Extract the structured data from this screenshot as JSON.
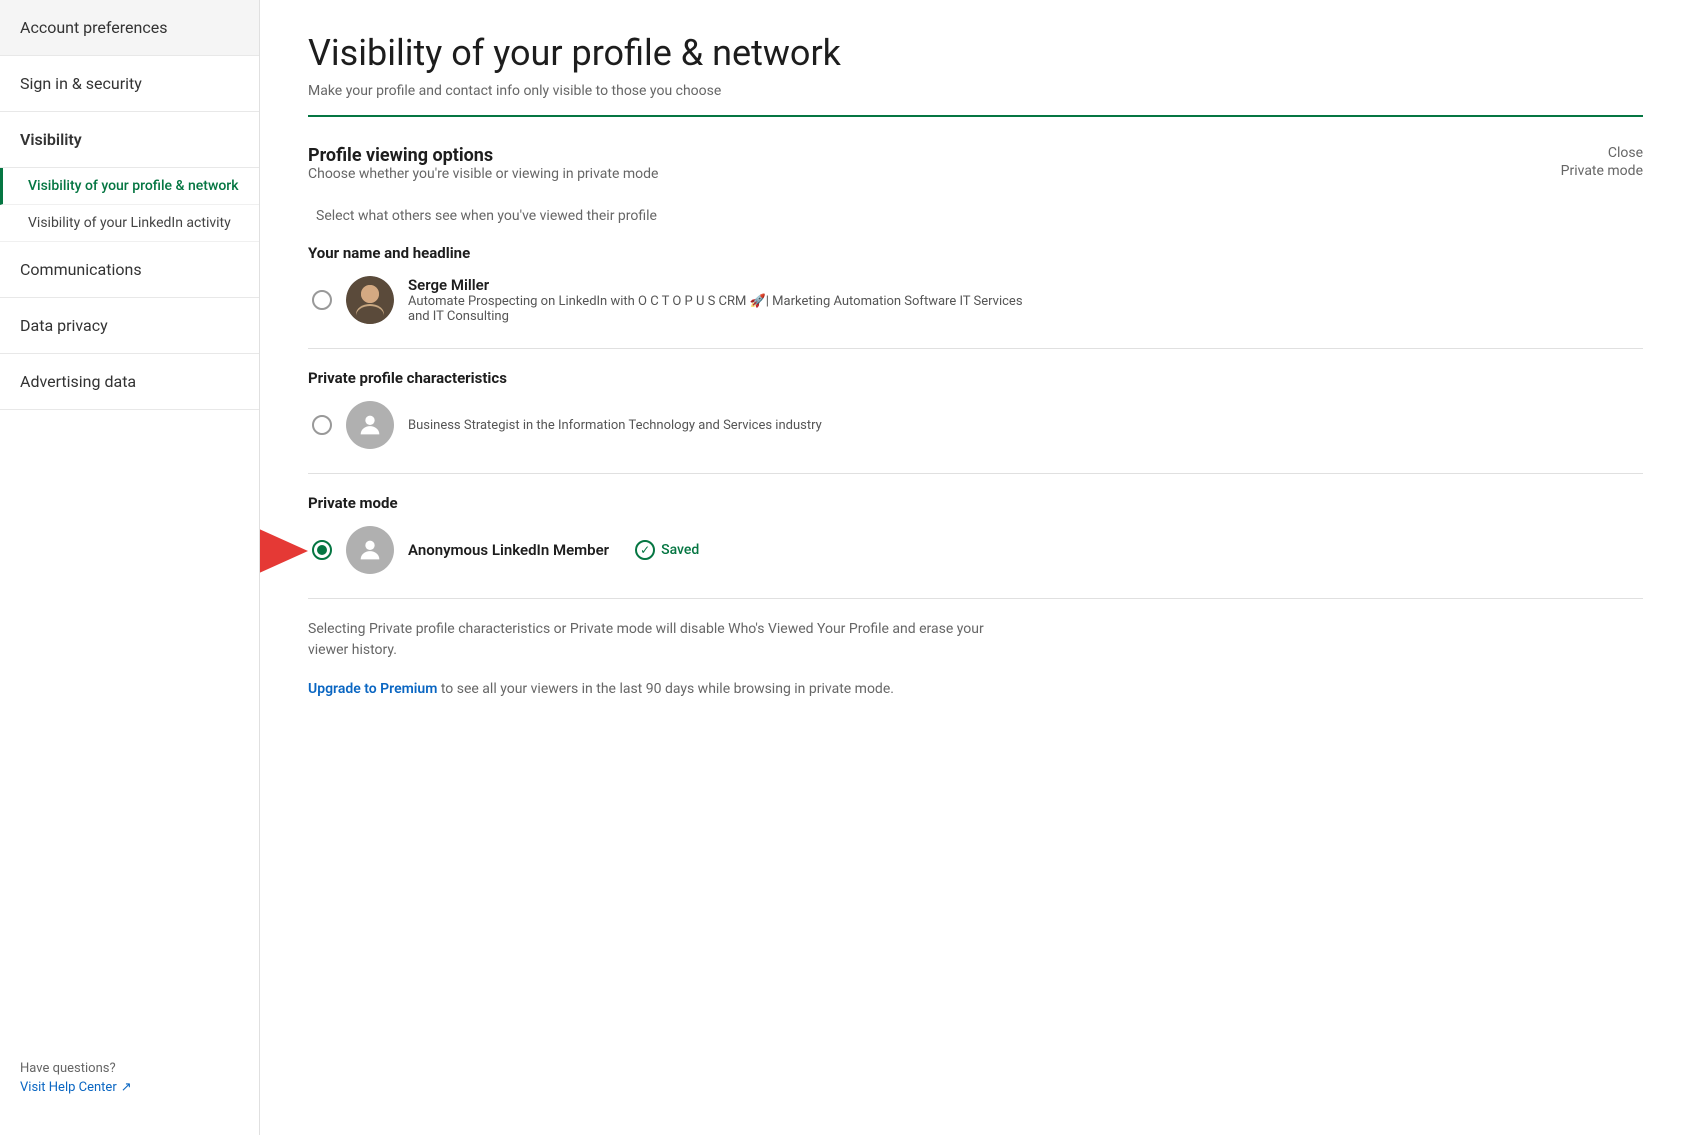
{
  "sidebar": {
    "items": [
      {
        "id": "account-preferences",
        "label": "Account preferences",
        "active": false
      },
      {
        "id": "sign-in-security",
        "label": "Sign in & security",
        "active": false
      },
      {
        "id": "visibility",
        "label": "Visibility",
        "active": true
      }
    ],
    "sub_items": [
      {
        "id": "visibility-profile-network",
        "label": "Visibility of your profile & network",
        "active": true
      },
      {
        "id": "visibility-linkedin-activity",
        "label": "Visibility of your LinkedIn activity",
        "active": false
      }
    ],
    "more_items": [
      {
        "id": "communications",
        "label": "Communications"
      },
      {
        "id": "data-privacy",
        "label": "Data privacy"
      },
      {
        "id": "advertising-data",
        "label": "Advertising data"
      }
    ],
    "footer": {
      "have_questions": "Have questions?",
      "visit_help_center": "Visit Help Center",
      "external_icon": "↗"
    }
  },
  "main": {
    "page_title": "Visibility of your profile & network",
    "page_subtitle": "Make your profile and contact info only visible to those you choose",
    "section": {
      "title": "Profile viewing options",
      "subtitle": "Choose whether you're visible or viewing in private mode",
      "close_label": "Close",
      "current_value": "Private mode",
      "select_instruction": "Select what others see when you've viewed their profile",
      "option_groups": [
        {
          "id": "your-name-headline",
          "label": "Your name and headline",
          "options": [
            {
              "id": "name-headline-option",
              "selected": false,
              "has_avatar": true,
              "avatar_type": "photo",
              "name": "Serge Miller",
              "description": "Automate Prospecting on LinkedIn with O C T O P U S CRM 🚀| Marketing Automation Software IT Services and IT Consulting"
            }
          ]
        },
        {
          "id": "private-profile-characteristics",
          "label": "Private profile characteristics",
          "options": [
            {
              "id": "private-profile-option",
              "selected": false,
              "has_avatar": true,
              "avatar_type": "placeholder",
              "name": null,
              "description": "Business Strategist in the Information Technology and Services industry"
            }
          ]
        },
        {
          "id": "private-mode",
          "label": "Private mode",
          "options": [
            {
              "id": "private-mode-option",
              "selected": true,
              "has_avatar": true,
              "avatar_type": "placeholder",
              "name": "Anonymous LinkedIn Member",
              "description": null,
              "saved": true,
              "saved_label": "Saved"
            }
          ]
        }
      ]
    },
    "footer_notes": [
      "Selecting Private profile characteristics or Private mode will disable Who's Viewed Your Profile and erase your viewer history.",
      "Upgrade to Premium to see all your viewers in the last 90 days while browsing in private mode."
    ],
    "upgrade_link_text": "Upgrade to Premium",
    "upgrade_link_rest": " to see all your viewers in the last 90 days while browsing in private mode."
  }
}
